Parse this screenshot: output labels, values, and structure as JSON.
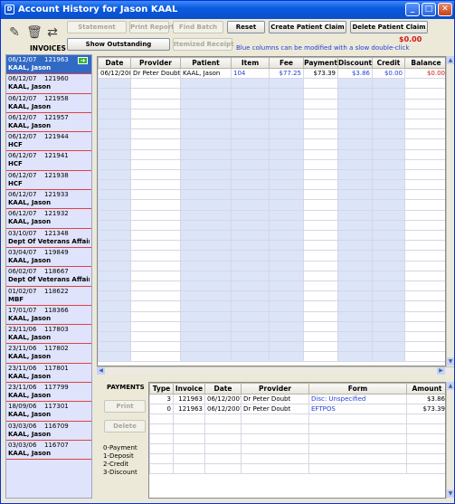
{
  "window": {
    "title": "Account History for Jason KAAL"
  },
  "toolbar": {
    "statement": "Statement",
    "print_report": "Print Report",
    "find_batch": "Find Batch",
    "reset": "Reset",
    "create_claim": "Create Patient Claim",
    "delete_claim": "Delete Patient Claim",
    "show_outstanding": "Show Outstanding",
    "itemized_receipt": "Itemized Receipt",
    "outstanding_amount": "$0.00",
    "info_text": "Blue columns can be modified with a slow double-click"
  },
  "invoices": {
    "label": "INVOICES",
    "items": [
      {
        "date": "06/12/07",
        "number": "121963",
        "name": "KAAL, Jason"
      },
      {
        "date": "06/12/07",
        "number": "121960",
        "name": "KAAL, Jason"
      },
      {
        "date": "06/12/07",
        "number": "121958",
        "name": "KAAL, Jason"
      },
      {
        "date": "06/12/07",
        "number": "121957",
        "name": "KAAL, Jason"
      },
      {
        "date": "06/12/07",
        "number": "121944",
        "name": "HCF"
      },
      {
        "date": "06/12/07",
        "number": "121941",
        "name": "HCF"
      },
      {
        "date": "06/12/07",
        "number": "121938",
        "name": "HCF"
      },
      {
        "date": "06/12/07",
        "number": "121933",
        "name": "KAAL, Jason"
      },
      {
        "date": "06/12/07",
        "number": "121932",
        "name": "KAAL, Jason"
      },
      {
        "date": "03/10/07",
        "number": "121348",
        "name": "Dept Of Veterans Affairs"
      },
      {
        "date": "03/04/07",
        "number": "119849",
        "name": "KAAL, Jason"
      },
      {
        "date": "06/02/07",
        "number": "118667",
        "name": "Dept Of Veterans Affairs"
      },
      {
        "date": "01/02/07",
        "number": "118622",
        "name": "MBF"
      },
      {
        "date": "17/01/07",
        "number": "118366",
        "name": "KAAL, Jason"
      },
      {
        "date": "23/11/06",
        "number": "117803",
        "name": "KAAL, Jason"
      },
      {
        "date": "23/11/06",
        "number": "117802",
        "name": "KAAL, Jason"
      },
      {
        "date": "23/11/06",
        "number": "117801",
        "name": "KAAL, Jason"
      },
      {
        "date": "23/11/06",
        "number": "117799",
        "name": "KAAL, Jason"
      },
      {
        "date": "18/09/06",
        "number": "117301",
        "name": "KAAL, Jason"
      },
      {
        "date": "03/03/06",
        "number": "116709",
        "name": "KAAL, Jason"
      },
      {
        "date": "03/03/06",
        "number": "116707",
        "name": "KAAL, Jason"
      }
    ]
  },
  "items_table": {
    "headers": [
      "Date",
      "Provider",
      "Patient",
      "Item",
      "Fee",
      "Payment",
      "Discount",
      "Credit",
      "Balance"
    ],
    "row": {
      "date": "06/12/2007",
      "provider": "Dr Peter Doubt",
      "patient": "KAAL, Jason",
      "item": "104",
      "fee": "$77.25",
      "payment": "$73.39",
      "discount": "$3.86",
      "credit": "$0.00",
      "balance": "$0.00"
    }
  },
  "payments": {
    "label": "PAYMENTS",
    "print": "Print",
    "delete": "Delete",
    "legend": [
      "0-Payment",
      "1-Deposit",
      "2-Credit",
      "3-Discount"
    ],
    "headers": [
      "Type",
      "Invoice",
      "Date",
      "Provider",
      "Form",
      "Amount"
    ],
    "rows": [
      {
        "type": "3",
        "invoice": "121963",
        "date": "06/12/2007",
        "provider": "Dr Peter Doubt",
        "form": "Disc: Unspecified",
        "amount": "$3.86"
      },
      {
        "type": "0",
        "invoice": "121963",
        "date": "06/12/2007",
        "provider": "Dr Peter Doubt",
        "form": "EFTPOS",
        "amount": "$73.39"
      }
    ]
  }
}
